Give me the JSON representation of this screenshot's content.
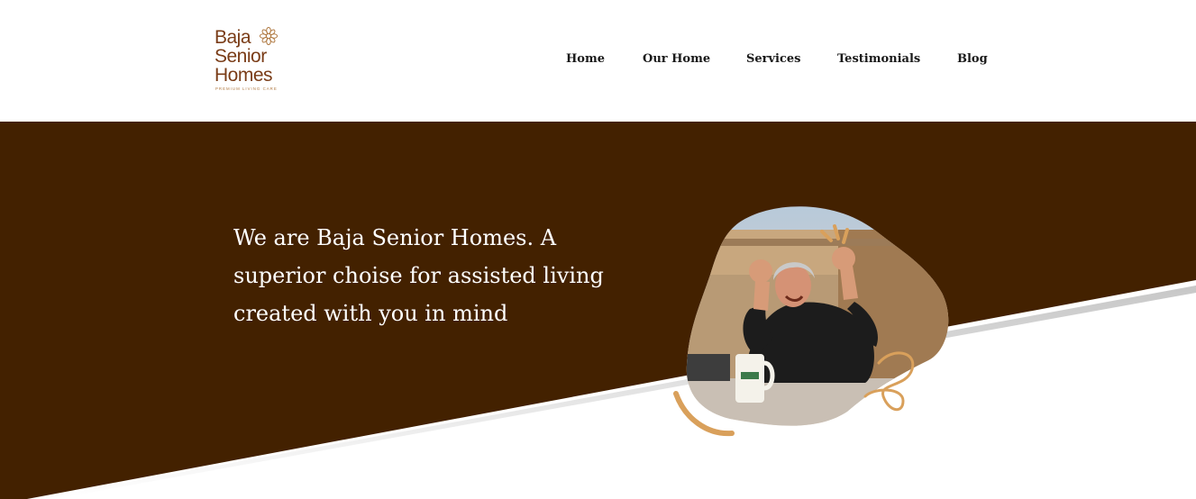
{
  "brand": {
    "name_line1": "Baja",
    "name_line2": "Senior",
    "name_line3": "Homes",
    "tagline": "PREMIUM LIVING CARE",
    "logo_icon": "flower-icon"
  },
  "nav": {
    "items": [
      {
        "label": "Home"
      },
      {
        "label": "Our Home"
      },
      {
        "label": "Services"
      },
      {
        "label": "Testimonials"
      },
      {
        "label": "Blog"
      }
    ]
  },
  "hero": {
    "headline": "We are Baja Senior Homes. A superior choise for assisted living created with you in mind",
    "image_subject": "senior man cheering with raised fists at outdoor table"
  },
  "colors": {
    "brand_brown": "#432100",
    "logo_brown": "#7a3c17",
    "accent_gold": "#d9a05b",
    "nav_text": "#1a1a1a",
    "hero_text": "#ffffff"
  }
}
